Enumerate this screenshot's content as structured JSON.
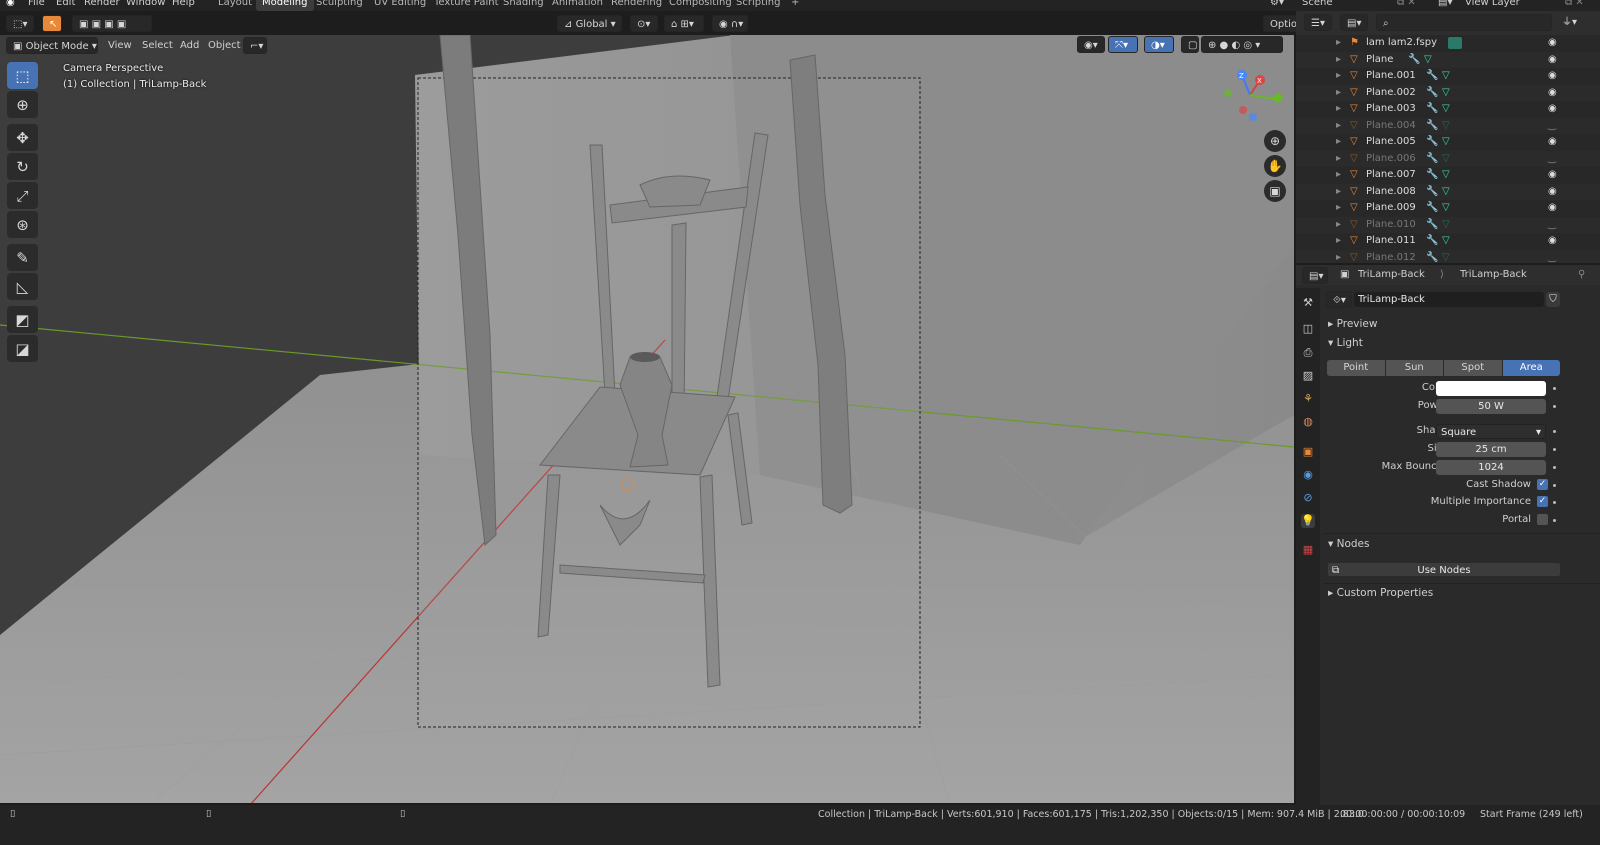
{
  "app": {
    "accent": "#4772b3",
    "active_orange": "#e8893a"
  },
  "topbar": {
    "menus": [
      "File",
      "Edit",
      "Render",
      "Window",
      "Help"
    ],
    "workspaces": [
      "Layout",
      "Modeling",
      "Sculpting",
      "UV Editing",
      "Texture Paint",
      "Shading",
      "Animation",
      "Rendering",
      "Compositing",
      "Scripting"
    ],
    "active_workspace": "Modeling",
    "add_tab": "+",
    "scene_label": "Scene",
    "view_layer_label": "View Layer"
  },
  "viewport_header": {
    "transform_orientation": "Global",
    "options_label": "Options",
    "mode_label": "Object Mode",
    "menus": [
      "View",
      "Select",
      "Add",
      "Object"
    ]
  },
  "viewport": {
    "overlay_title": "Camera Perspective",
    "overlay_collection": "(1) Collection | TriLamp-Back"
  },
  "gizmo": {
    "x": "X",
    "y": "Y",
    "z": "Z"
  },
  "outliner": {
    "search_placeholder": "",
    "rows": [
      {
        "name": "lam lam2.fspy",
        "dim": false,
        "hidden": false
      },
      {
        "name": "Plane",
        "dim": false,
        "hidden": false
      },
      {
        "name": "Plane.001",
        "dim": false,
        "hidden": false
      },
      {
        "name": "Plane.002",
        "dim": false,
        "hidden": false
      },
      {
        "name": "Plane.003",
        "dim": false,
        "hidden": false
      },
      {
        "name": "Plane.004",
        "dim": true,
        "hidden": true
      },
      {
        "name": "Plane.005",
        "dim": false,
        "hidden": false
      },
      {
        "name": "Plane.006",
        "dim": true,
        "hidden": true
      },
      {
        "name": "Plane.007",
        "dim": false,
        "hidden": false
      },
      {
        "name": "Plane.008",
        "dim": false,
        "hidden": false
      },
      {
        "name": "Plane.009",
        "dim": false,
        "hidden": false
      },
      {
        "name": "Plane.010",
        "dim": true,
        "hidden": true
      },
      {
        "name": "Plane.011",
        "dim": false,
        "hidden": false
      },
      {
        "name": "Plane.012",
        "dim": true,
        "hidden": true
      }
    ]
  },
  "properties": {
    "breadcrumb_object": "TriLamp-Back",
    "breadcrumb_data": "TriLamp-Back",
    "datablock_name": "TriLamp-Back",
    "sections": {
      "preview": "Preview",
      "light": "Light",
      "nodes": "Nodes",
      "custom_properties": "Custom Properties"
    },
    "light_types": [
      "Point",
      "Sun",
      "Spot",
      "Area"
    ],
    "active_light_type": "Area",
    "fields": {
      "color_label": "Color",
      "power_label": "Power",
      "power_value": "50 W",
      "shape_label": "Shape",
      "shape_value": "Square",
      "size_label": "Size",
      "size_value": "25 cm",
      "max_bounces_label": "Max Bounces",
      "max_bounces_value": "1024",
      "cast_shadow_label": "Cast Shadow",
      "cast_shadow": true,
      "multiple_importance_label": "Multiple Importance",
      "multiple_importance": true,
      "portal_label": "Portal",
      "portal": false
    },
    "use_nodes_label": "Use Nodes"
  },
  "statusbar": {
    "stats": "Collection | TriLamp-Back | Verts:601,910 | Faces:601,175 | Tris:1,202,350 | Objects:0/15 | Mem: 907.4 MiB | 2.83.0",
    "timecode": "00:00:00:00 / 00:00:10:09",
    "start_frame": "Start Frame (249 left)"
  }
}
